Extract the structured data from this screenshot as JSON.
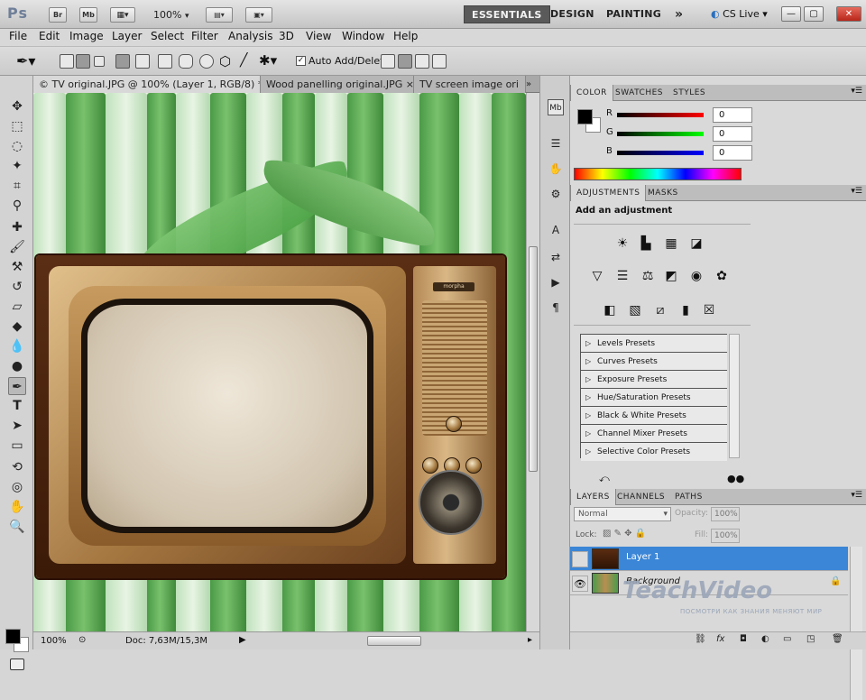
{
  "app": {
    "logo": "Ps",
    "bridge_btn": "Br",
    "minibridge_btn": "Mb",
    "zoom": "100%",
    "workspaces": [
      "ESSENTIALS",
      "DESIGN",
      "PAINTING"
    ],
    "more": "»",
    "cs_live": "CS Live"
  },
  "menu": [
    "File",
    "Edit",
    "Image",
    "Layer",
    "Select",
    "Filter",
    "Analysis",
    "3D",
    "View",
    "Window",
    "Help"
  ],
  "options": {
    "auto_add_delete": "Auto Add/Delete"
  },
  "tabs": [
    "© TV original.JPG @ 100% (Layer 1, RGB/8) * ×",
    "Wood panelling original.JPG ×",
    "TV screen image ori"
  ],
  "tabs_more": "»",
  "tv_brand": "morpha",
  "status": {
    "zoom": "100%",
    "doc": "Doc: 7,63M/15,3M"
  },
  "color_panel": {
    "tabs": [
      "COLOR",
      "SWATCHES",
      "STYLES"
    ],
    "r_label": "R",
    "g_label": "G",
    "b_label": "B",
    "r_value": "0",
    "g_value": "0",
    "b_value": "0"
  },
  "adjustments": {
    "tabs": [
      "ADJUSTMENTS",
      "MASKS"
    ],
    "title": "Add an adjustment",
    "presets": [
      "Levels Presets",
      "Curves Presets",
      "Exposure Presets",
      "Hue/Saturation Presets",
      "Black & White Presets",
      "Channel Mixer Presets",
      "Selective Color Presets"
    ]
  },
  "layers_panel": {
    "tabs": [
      "LAYERS",
      "CHANNELS",
      "PATHS"
    ],
    "blend_mode": "Normal",
    "opacity_label": "Opacity:",
    "opacity_value": "100%",
    "lock_label": "Lock:",
    "fill_label": "Fill:",
    "fill_value": "100%",
    "layers": [
      "Layer 1",
      "Background"
    ]
  },
  "watermark": {
    "brand": "TeachVideo",
    "tagline": "ПОСМОТРИ КАК ЗНАНИЯ МЕНЯЮТ МИР"
  },
  "colors": {
    "selected_layer": "#3b86d6",
    "active_workspace": "#5a5a5a"
  }
}
